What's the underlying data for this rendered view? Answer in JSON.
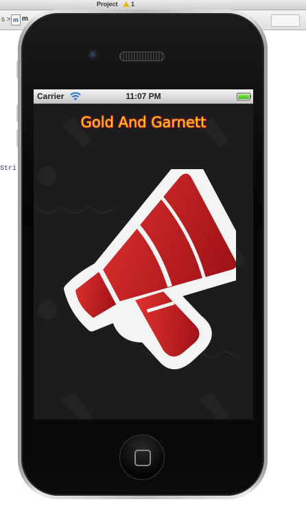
{
  "xcode": {
    "window_title": "Project",
    "warning_count": "1",
    "breadcrumb_sep": "s >",
    "file_icon_letter": "m",
    "file_name": "m",
    "code_snippet": "Stri"
  },
  "status_bar": {
    "carrier": "Carrier",
    "time": "11:07 PM",
    "battery_level": 1.0
  },
  "app": {
    "title": "Gold And Garnett",
    "title_color": "#f5d21b",
    "title_outline_color": "#c0202a",
    "main_icon": "megaphone-icon",
    "megaphone_color": "#c41e24"
  }
}
